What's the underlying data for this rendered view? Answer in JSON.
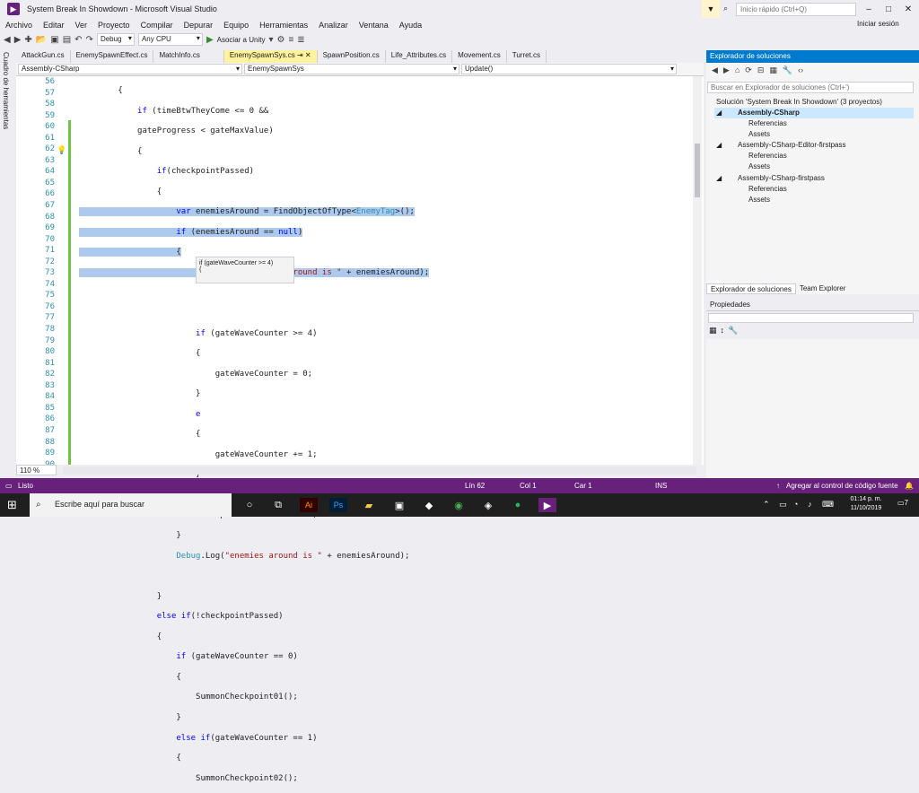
{
  "window": {
    "title": "System Break In Showdown - Microsoft Visual Studio",
    "quick_launch_placeholder": "Inicio rápido (Ctrl+Q)",
    "signin": "Iniciar sesión"
  },
  "menu": [
    "Archivo",
    "Editar",
    "Ver",
    "Proyecto",
    "Compilar",
    "Depurar",
    "Equipo",
    "Herramientas",
    "Analizar",
    "Ventana",
    "Ayuda"
  ],
  "toolbar": {
    "config": "Debug",
    "platform": "Any CPU",
    "attach": "Asociar a Unity"
  },
  "left_rail": "Cuadro de herramientas",
  "tabs": [
    "AttackGun.cs",
    "EnemySpawnEffect.cs",
    "MatchInfo.cs",
    "EnemySpawnSys.cs",
    "SpawnPosition.cs",
    "Life_Attributes.cs",
    "Movement.cs",
    "Turret.cs"
  ],
  "active_tab": 3,
  "navbar": {
    "project": "Assembly-CSharp",
    "class": "EnemySpawnSys",
    "member": "Update()"
  },
  "editor": {
    "zoom": "110 %",
    "tooltip_line1": "if (gateWaveCounter >= 4)",
    "tooltip_line2": "{",
    "line_numbers": [
      "56",
      "57",
      "58",
      "59",
      "60",
      "61",
      "62",
      "63",
      "64",
      "65",
      "66",
      "67",
      "68",
      "69",
      "70",
      "71",
      "72",
      "73",
      "74",
      "75",
      "76",
      "77",
      "78",
      "79",
      "80",
      "81",
      "82",
      "83",
      "84",
      "85",
      "86",
      "87",
      "88",
      "89",
      "90"
    ]
  },
  "solution_explorer": {
    "title": "Explorador de soluciones",
    "search_placeholder": "Buscar en Explorador de soluciones (Ctrl+')",
    "items": [
      {
        "label": "Solución 'System Break In Showdown'  (3 proyectos)"
      },
      {
        "label": "Assembly-CSharp"
      },
      {
        "label": "Referencias"
      },
      {
        "label": "Assets"
      },
      {
        "label": "Assembly-CSharp-Editor-firstpass"
      },
      {
        "label": "Referencias"
      },
      {
        "label": "Assets"
      },
      {
        "label": "Assembly-CSharp-firstpass"
      },
      {
        "label": "Referencias"
      },
      {
        "label": "Assets"
      }
    ],
    "tab_active": "Explorador de soluciones",
    "tab_other": "Team Explorer"
  },
  "properties": {
    "title": "Propiedades"
  },
  "status": {
    "ready": "Listo",
    "line": "Lín 62",
    "col": "Col 1",
    "char": "Car 1",
    "mode": "INS",
    "scm": "Agregar al control de código fuente"
  },
  "taskbar": {
    "search": "Escribe aquí para buscar",
    "time": "01:14 p. m.",
    "date": "11/10/2019",
    "notifications": "7"
  },
  "colors": {
    "accent": "#007acc",
    "status": "#68217a",
    "selection": "#adc9ed",
    "active_tab": "#fff29d"
  }
}
